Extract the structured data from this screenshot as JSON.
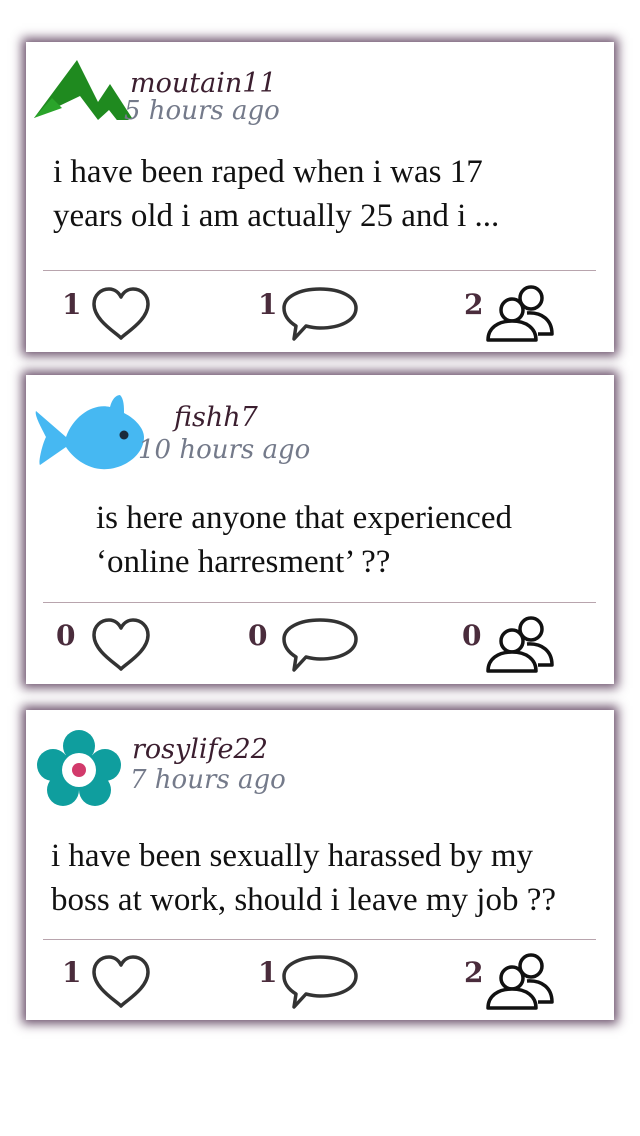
{
  "posts": [
    {
      "username": "moutain11",
      "time": "5 hours ago",
      "text_lines": [
        "i have been raped when i was 17",
        "years old i am actually 25 and i ..."
      ],
      "likes": "1",
      "comments": "1",
      "followers": "2",
      "avatar_icon": "mountain-icon",
      "avatar_color": "#1f8a1f"
    },
    {
      "username": "fishh7",
      "time": "10 hours ago",
      "text_lines": [
        "is here anyone that experienced",
        "‘online harresment’ ??"
      ],
      "likes": "0",
      "comments": "0",
      "followers": "0",
      "avatar_icon": "fish-icon",
      "avatar_color": "#46b8f2"
    },
    {
      "username": "rosylife22",
      "time": "7 hours ago",
      "text_lines": [
        "i have been sexually harassed by my",
        "boss at work, should i leave my job ??"
      ],
      "likes": "1",
      "comments": "1",
      "followers": "2",
      "avatar_icon": "flower-icon",
      "avatar_color": "#0f9e9e"
    }
  ],
  "colors": {
    "card_shadow": "#3c193c",
    "username": "#3b1e2f",
    "timestamp": "#747a8a",
    "count": "#4a2c3c",
    "icon_stroke": "#333333",
    "divider": "#b8a4ad"
  }
}
